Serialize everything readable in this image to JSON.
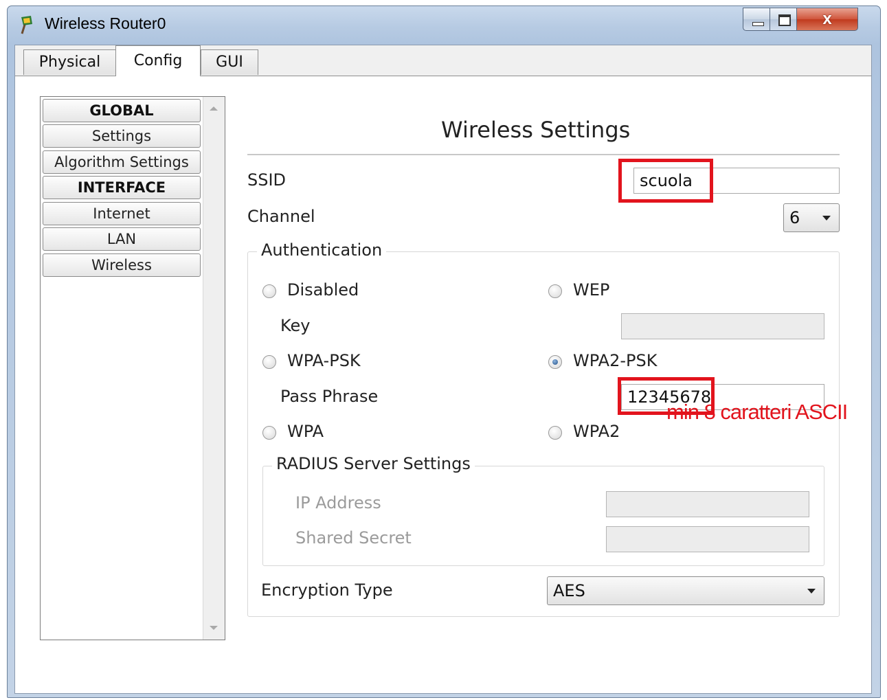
{
  "window": {
    "title": "Wireless Router0",
    "close_glyph": "x"
  },
  "tabs": [
    {
      "label": "Physical"
    },
    {
      "label": "Config"
    },
    {
      "label": "GUI"
    }
  ],
  "sidebar": {
    "items": [
      {
        "label": "GLOBAL",
        "type": "header"
      },
      {
        "label": "Settings"
      },
      {
        "label": "Algorithm Settings"
      },
      {
        "label": "INTERFACE",
        "type": "header"
      },
      {
        "label": "Internet"
      },
      {
        "label": "LAN"
      },
      {
        "label": "Wireless"
      }
    ]
  },
  "main": {
    "heading": "Wireless Settings",
    "ssid_label": "SSID",
    "ssid_value": "scuola",
    "channel_label": "Channel",
    "channel_value": "6",
    "auth_legend": "Authentication",
    "opt_disabled": "Disabled",
    "opt_wep": "WEP",
    "key_label": "Key",
    "key_value": "",
    "opt_wpa_psk": "WPA-PSK",
    "opt_wpa2_psk": "WPA2-PSK",
    "passphrase_label": "Pass Phrase",
    "passphrase_value": "12345678",
    "opt_wpa": "WPA",
    "opt_wpa2": "WPA2",
    "selected_auth": "WPA2-PSK",
    "radius_legend": "RADIUS Server Settings",
    "ip_label": "IP Address",
    "ip_value": "",
    "secret_label": "Shared Secret",
    "secret_value": "",
    "encryption_label": "Encryption Type",
    "encryption_value": "AES"
  },
  "annotation": "min 8 caratteri ASCII",
  "colors": {
    "annotation": "#e2141d",
    "highlight_box": "#e2141d"
  }
}
